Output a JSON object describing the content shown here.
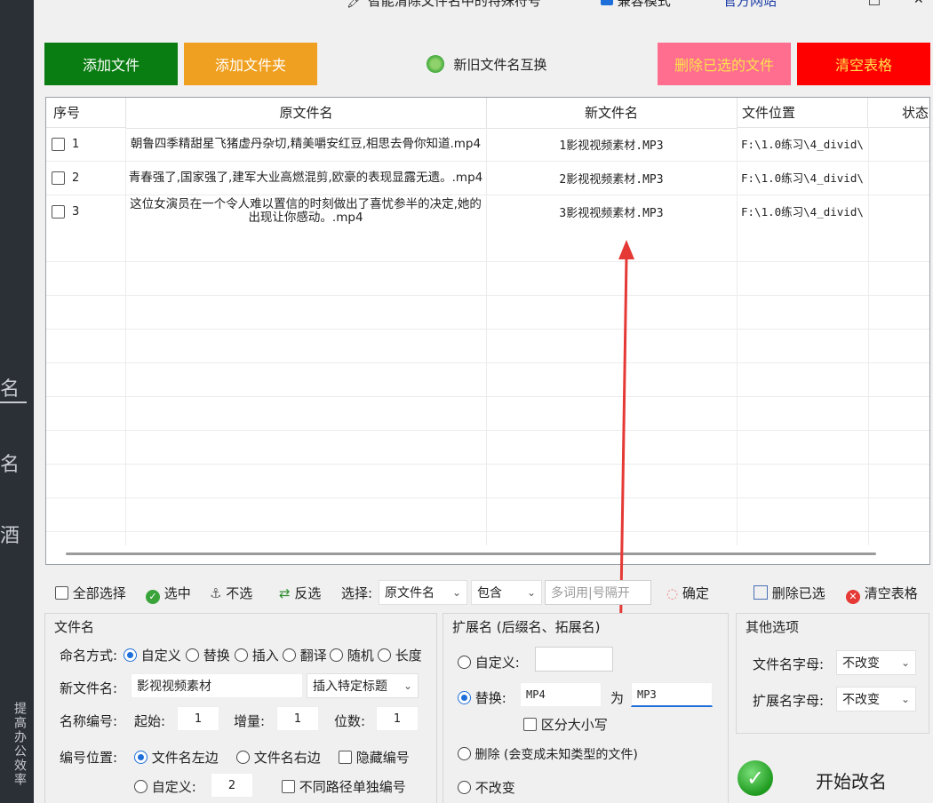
{
  "left_sidebar": {
    "glyphs": [
      "名",
      "名",
      "酒"
    ],
    "vertical_text": "提高办公效率"
  },
  "top_toolbar": {
    "clean_names_label": "智能清除文件名中的特殊符号",
    "compat_mode_label": "兼容模式",
    "official_site_label": "官方网站"
  },
  "actions": {
    "add_file": "添加文件",
    "add_folder": "添加文件夹",
    "swap_names": "新旧文件名互换",
    "delete_selected": "删除已选的文件",
    "clear_table": "清空表格"
  },
  "colors": {
    "add_file": "#0a7d12",
    "add_folder": "#f0a020",
    "delete_selected": "#ff6d8f",
    "clear_table": "#ff0000",
    "delete_text": "#ffe14d",
    "clear_text": "#ffe14d",
    "arrow": "#e53935"
  },
  "table": {
    "headers": [
      "序号",
      "原文件名",
      "新文件名",
      "文件位置",
      "状态"
    ],
    "rows": [
      {
        "num": "1",
        "original": "朝鲁四季精甜星飞猪虚丹杂切,精美嚼安红豆,相思去骨你知道.mp4",
        "new": "1影视视频素材.MP3",
        "location": "F:\\1.0练习\\4_divid\\"
      },
      {
        "num": "2",
        "original": "青春强了,国家强了,建军大业高燃混剪,欧豪的表现显露无遗。.mp4",
        "new": "2影视视频素材.MP3",
        "location": "F:\\1.0练习\\4_divid\\"
      },
      {
        "num": "3",
        "original": "这位女演员在一个令人难以置信的时刻做出了喜忧参半的决定,她的出现让你感动。.mp4",
        "new": "3影视视频素材.MP3",
        "location": "F:\\1.0练习\\4_divid\\"
      }
    ]
  },
  "selection_bar": {
    "select_all": "全部选择",
    "select": "选中",
    "unselect": "不选",
    "invert": "反选",
    "choose_label": "选择:",
    "field_value": "原文件名",
    "match_value": "包含",
    "keywords_placeholder": "多词用|号隔开",
    "confirm": "确定",
    "delete_selected": "删除已选",
    "clear_table": "清空表格"
  },
  "filename_panel": {
    "title": "文件名",
    "naming_label": "命名方式:",
    "modes": [
      "自定义",
      "替换",
      "插入",
      "翻译",
      "随机",
      "长度"
    ],
    "new_name_label": "新文件名:",
    "new_name_value": "影视视频素材",
    "insert_title": "插入特定标题",
    "numbering_label": "名称编号:",
    "start_label": "起始:",
    "start_value": "1",
    "increment_label": "增量:",
    "increment_value": "1",
    "digits_label": "位数:",
    "digits_value": "1",
    "position_label": "编号位置:",
    "left_label": "文件名左边",
    "right_label": "文件名右边",
    "hide_label": "隐藏编号",
    "custom_label": "自定义:",
    "custom_value": "2",
    "path_label": "不同路径单独编号"
  },
  "extension_panel": {
    "title": "扩展名 (后缀名、拓展名)",
    "custom_label": "自定义:",
    "replace_label": "替换:",
    "replace_from": "MP4",
    "to_label": "为",
    "replace_to": "MP3",
    "case_label": "区分大小写",
    "delete_label": "删除 (会变成未知类型的文件)",
    "keep_label": "不改变"
  },
  "other_panel": {
    "title": "其他选项",
    "name_case_label": "文件名字母:",
    "name_case_value": "不改变",
    "ext_case_label": "扩展名字母:",
    "ext_case_value": "不改变"
  },
  "start_button": "开始改名"
}
